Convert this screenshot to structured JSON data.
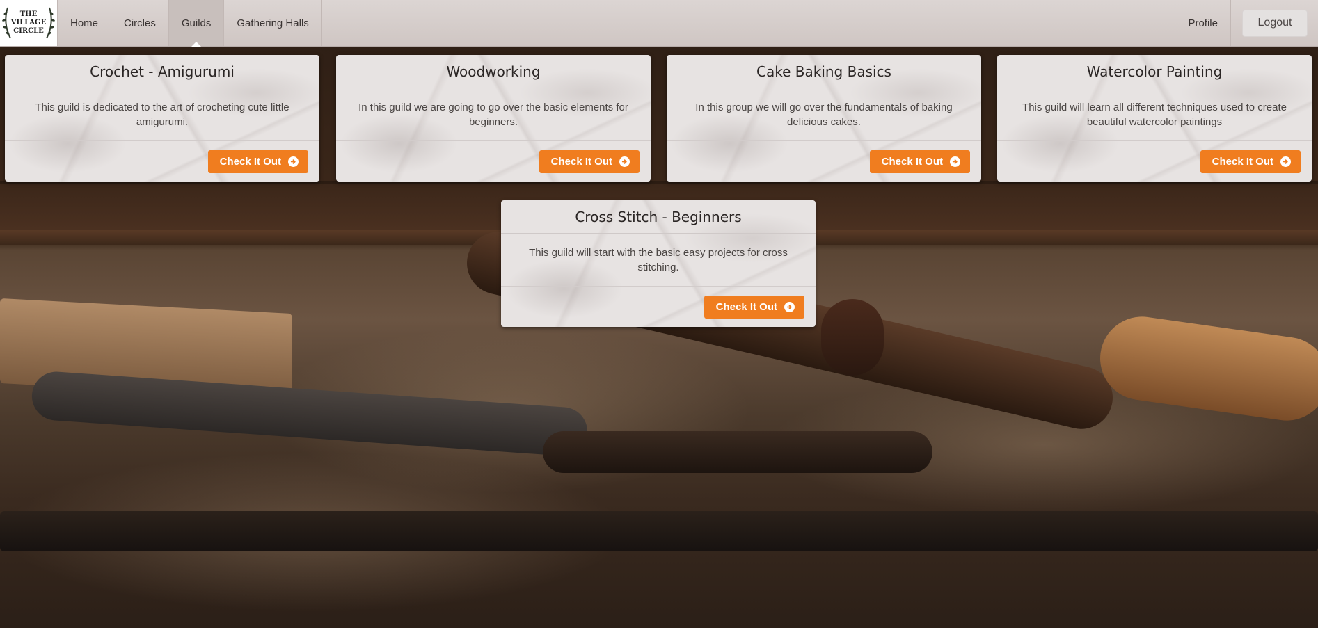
{
  "app": {
    "logo_alt": "THE VILLAGE CIRCLE",
    "logo_lines": [
      "THE",
      "VILLAGE",
      "CIRCLE"
    ]
  },
  "nav": {
    "items": [
      {
        "label": "Home"
      },
      {
        "label": "Circles"
      },
      {
        "label": "Guilds",
        "active": true
      },
      {
        "label": "Gathering Halls"
      }
    ],
    "profile_label": "Profile",
    "logout_label": "Logout"
  },
  "colors": {
    "accent": "#f07d1f",
    "navbar": "#d6cecb",
    "card": "#e7e3e2"
  },
  "guilds": [
    {
      "title": "Crochet - Amigurumi",
      "description": "This guild is dedicated to the art of crocheting cute little amigurumi.",
      "button": "Check It Out",
      "icon": "arrow-circle-right-icon"
    },
    {
      "title": "Woodworking",
      "description": "In this guild we are going to go over the basic elements for beginners.",
      "button": "Check It Out",
      "icon": "arrow-circle-right-icon"
    },
    {
      "title": "Cake Baking Basics",
      "description": "In this group we will go over the fundamentals of baking delicious cakes.",
      "button": "Check It Out",
      "icon": "arrow-circle-right-icon"
    },
    {
      "title": "Watercolor Painting",
      "description": "This guild will learn all different techniques used to create beautiful watercolor paintings",
      "button": "Check It Out",
      "icon": "arrow-circle-right-icon"
    },
    {
      "title": "Cross Stitch - Beginners",
      "description": "This guild will start with the basic easy projects for cross stitching.",
      "button": "Check It Out",
      "icon": "arrow-circle-right-icon"
    }
  ]
}
